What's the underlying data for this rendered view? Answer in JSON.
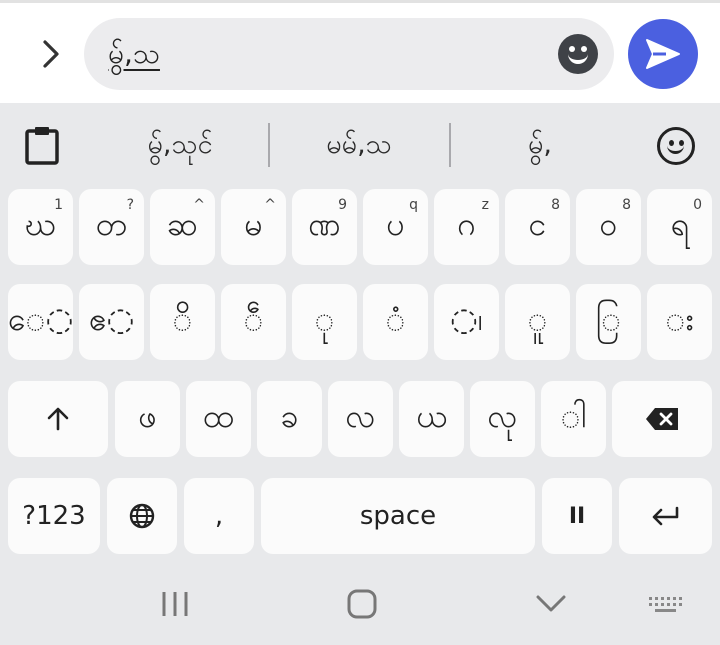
{
  "message": {
    "input_text": "မွ်,သ"
  },
  "suggestions": [
    "မွ်,သုင်",
    "မမ်,သ",
    "မွ်,"
  ],
  "rows": [
    [
      {
        "main": "ဃ",
        "hint": "1"
      },
      {
        "main": "တ",
        "hint": "?"
      },
      {
        "main": "ဆ",
        "hint": "^"
      },
      {
        "main": "မ",
        "hint": "^"
      },
      {
        "main": "ဏ",
        "hint": "9"
      },
      {
        "main": "ပ",
        "hint": "q"
      },
      {
        "main": "ဂ",
        "hint": "z"
      },
      {
        "main": "င",
        "hint": "8"
      },
      {
        "main": "ဝ",
        "hint": "8"
      },
      {
        "main": "ရ",
        "hint": "0"
      }
    ],
    [
      {
        "main": "ေ◌"
      },
      {
        "main": "ဧ◌"
      },
      {
        "main": "ိ"
      },
      {
        "main": "ဵ"
      },
      {
        "main": "ု"
      },
      {
        "main": "◌ံ"
      },
      {
        "main": "◌၊"
      },
      {
        "main": "ူ"
      },
      {
        "main": "ြ"
      },
      {
        "main": "◌း"
      }
    ],
    [
      {
        "main": "ဖ"
      },
      {
        "main": "ထ"
      },
      {
        "main": "ခ"
      },
      {
        "main": "လ"
      },
      {
        "main": "ယ"
      },
      {
        "main": "လု"
      },
      {
        "main": "◌ါ"
      }
    ]
  ],
  "bottom": {
    "symbols": "?123",
    "comma": ",",
    "space": "space",
    "pause": "II"
  },
  "colors": {
    "send": "#4b60e0",
    "keyboard_bg": "#e8e9eb",
    "key_bg": "#fbfbfb"
  },
  "icons": [
    "chevron-right-icon",
    "emoji-icon",
    "send-icon",
    "clipboard-icon",
    "smiley-icon",
    "shift-icon",
    "backspace-icon",
    "globe-icon",
    "enter-icon",
    "recents-icon",
    "home-icon",
    "back-icon",
    "keyboard-icon"
  ]
}
